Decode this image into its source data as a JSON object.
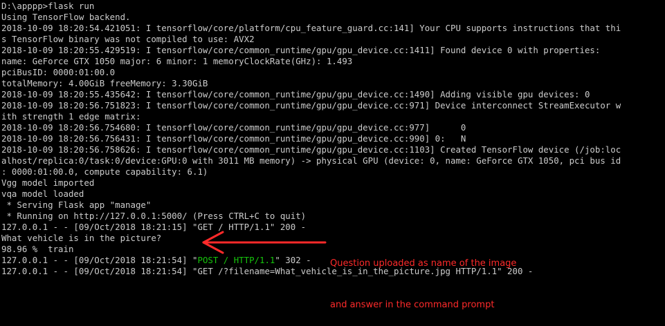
{
  "terminal": {
    "lines": [
      [
        {
          "text": "D:\\apppp>flask run"
        }
      ],
      [
        {
          "text": "Using TensorFlow backend."
        }
      ],
      [
        {
          "text": "2018-10-09 18:20:54.421051: I tensorflow/core/platform/cpu_feature_guard.cc:141] Your CPU supports instructions that thi"
        }
      ],
      [
        {
          "text": "s TensorFlow binary was not compiled to use: AVX2"
        }
      ],
      [
        {
          "text": "2018-10-09 18:20:55.429519: I tensorflow/core/common_runtime/gpu/gpu_device.cc:1411] Found device 0 with properties:"
        }
      ],
      [
        {
          "text": "name: GeForce GTX 1050 major: 6 minor: 1 memoryClockRate(GHz): 1.493"
        }
      ],
      [
        {
          "text": "pciBusID: 0000:01:00.0"
        }
      ],
      [
        {
          "text": "totalMemory: 4.00GiB freeMemory: 3.30GiB"
        }
      ],
      [
        {
          "text": "2018-10-09 18:20:55.435642: I tensorflow/core/common_runtime/gpu/gpu_device.cc:1490] Adding visible gpu devices: 0"
        }
      ],
      [
        {
          "text": "2018-10-09 18:20:56.751823: I tensorflow/core/common_runtime/gpu/gpu_device.cc:971] Device interconnect StreamExecutor w"
        }
      ],
      [
        {
          "text": "ith strength 1 edge matrix:"
        }
      ],
      [
        {
          "text": "2018-10-09 18:20:56.754680: I tensorflow/core/common_runtime/gpu/gpu_device.cc:977]      0"
        }
      ],
      [
        {
          "text": "2018-10-09 18:20:56.756431: I tensorflow/core/common_runtime/gpu/gpu_device.cc:990] 0:   N"
        }
      ],
      [
        {
          "text": "2018-10-09 18:20:56.758626: I tensorflow/core/common_runtime/gpu/gpu_device.cc:1103] Created TensorFlow device (/job:loc"
        }
      ],
      [
        {
          "text": "alhost/replica:0/task:0/device:GPU:0 with 3011 MB memory) -> physical GPU (device: 0, name: GeForce GTX 1050, pci bus id"
        }
      ],
      [
        {
          "text": ": 0000:01:00.0, compute capability: 6.1)"
        }
      ],
      [
        {
          "text": "Vgg model imported"
        }
      ],
      [
        {
          "text": "vqa model loaded"
        }
      ],
      [
        {
          "text": " * Serving Flask app \"manage\""
        }
      ],
      [
        {
          "text": " * Running on http://127.0.0.1:5000/ (Press CTRL+C to quit)"
        }
      ],
      [
        {
          "text": "127.0.0.1 - - [09/Oct/2018 18:21:15] \"GET / HTTP/1.1\" 200 -"
        }
      ],
      [
        {
          "text": "What vehicle is in the picture?"
        }
      ],
      [
        {
          "text": "98.96 %  train"
        }
      ],
      [
        {
          "text": "127.0.0.1 - - [09/Oct/2018 18:21:54] \""
        },
        {
          "text": "POST / HTTP/1.1",
          "color": "green"
        },
        {
          "text": "\" 302 -"
        }
      ],
      [
        {
          "text": "127.0.0.1 - - [09/Oct/2018 18:21:54] \"GET /?filename=What_vehicle_is_in_the_picture.jpg HTTP/1.1\" 200 -"
        }
      ]
    ]
  },
  "annotation": {
    "lines": [
      "Question uploaded as name of the image",
      "and answer in the command prompt"
    ],
    "color": "#ff2a2a"
  }
}
